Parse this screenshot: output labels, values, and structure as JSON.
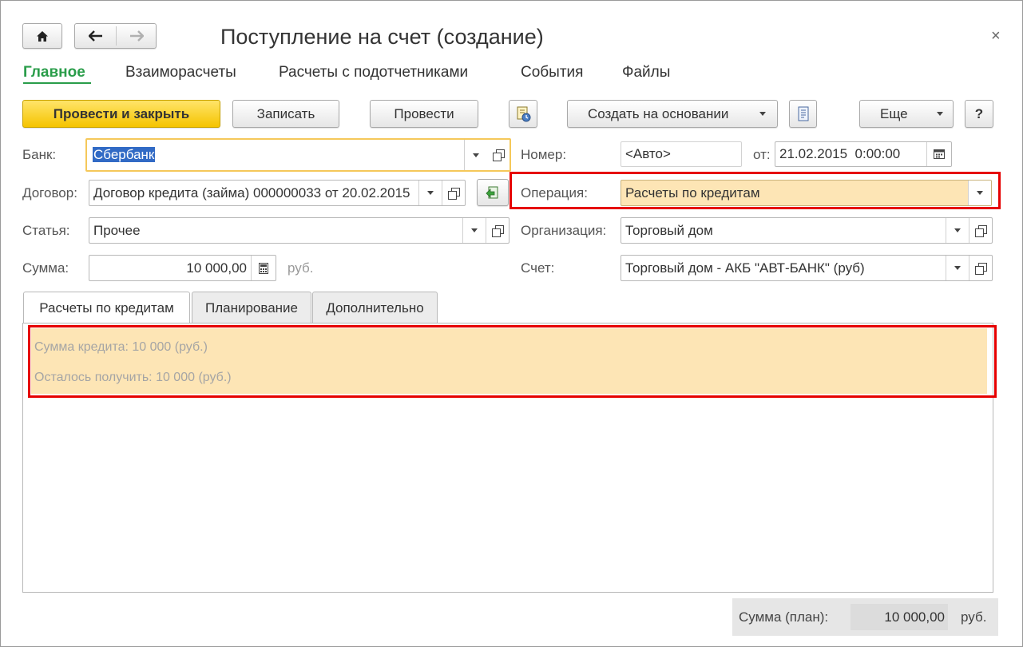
{
  "window": {
    "title": "Поступление на счет (создание)",
    "close_glyph": "×"
  },
  "colors": {
    "accent_green": "#2a9d4a",
    "primary_yellow": "#f5c400",
    "highlight_orange": "#fde5b5",
    "annotation_red": "#e60000",
    "selection_blue": "#316ac5"
  },
  "nav": {
    "items": [
      {
        "label": "Главное",
        "active": true
      },
      {
        "label": "Взаиморасчеты"
      },
      {
        "label": "Расчеты с подотчетниками"
      },
      {
        "label": "События"
      },
      {
        "label": "Файлы"
      }
    ]
  },
  "toolbar": {
    "post_close": "Провести и закрыть",
    "save": "Записать",
    "post": "Провести",
    "create_based_on": "Создать на основании",
    "more": "Еще",
    "help": "?"
  },
  "form": {
    "bank": {
      "label": "Банк:",
      "value": "Сбербанк"
    },
    "number": {
      "label": "Номер:",
      "placeholder": "<Авто>"
    },
    "date": {
      "label": "от:",
      "value": "21.02.2015  0:00:00"
    },
    "contract": {
      "label": "Договор:",
      "value": "Договор кредита (займа) 000000033 от 20.02.2015"
    },
    "operation": {
      "label": "Операция:",
      "value": "Расчеты по кредитам"
    },
    "article": {
      "label": "Статья:",
      "value": "Прочее"
    },
    "organization": {
      "label": "Организация:",
      "value": "Торговый дом"
    },
    "amount": {
      "label": "Сумма:",
      "value": "10 000,00",
      "currency": "руб."
    },
    "account": {
      "label": "Счет:",
      "value": "Торговый дом - АКБ \"АВТ-БАНК\" (руб)"
    }
  },
  "tabs": [
    {
      "label": "Расчеты по кредитам",
      "active": true
    },
    {
      "label": "Планирование"
    },
    {
      "label": "Дополнительно"
    }
  ],
  "credit_info": {
    "line1": "Сумма кредита: 10 000 (руб.)",
    "line2": "Осталось получить: 10 000 (руб.)"
  },
  "footer": {
    "label": "Сумма (план):",
    "value": "10 000,00",
    "currency": "руб."
  },
  "icons": {
    "home": "home-icon",
    "back": "arrow-left-icon",
    "forward": "arrow-right-icon",
    "calendar": "calendar-icon",
    "calculator": "calculator-icon",
    "report": "report-icon",
    "document_link": "document-link-icon"
  }
}
